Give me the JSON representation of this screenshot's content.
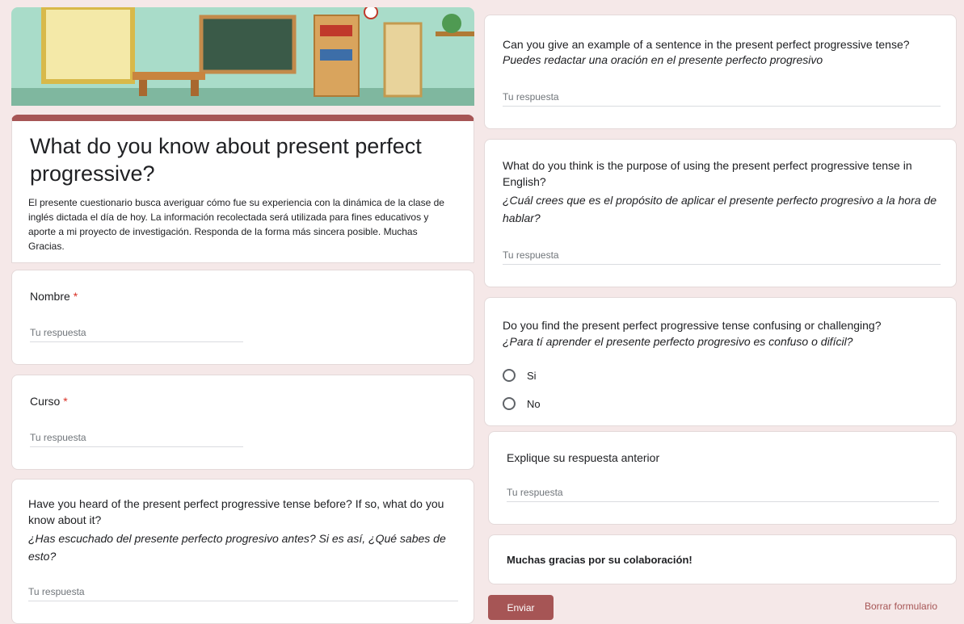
{
  "form": {
    "title": "What do you know about present perfect progressive?",
    "description": "El presente cuestionario busca averiguar cómo fue su experiencia con la dinámica de la clase de inglés dictada el día de hoy. La información recolectada será utilizada para fines educativos y aporte a mi proyecto de investigación. Responda de la forma más sincera posible. Muchas Gracias.",
    "accent_color": "#a65555",
    "placeholder": "Tu respuesta"
  },
  "left": {
    "nombre": {
      "label": "Nombre",
      "required_mark": "*",
      "answer": "Tu respuesta"
    },
    "curso": {
      "label": "Curso",
      "required_mark": "*",
      "answer": "Tu respuesta"
    },
    "heard": {
      "question_en": "Have you heard of the present perfect progressive tense before? If so, what do you know about it?",
      "question_es": "¿Has escuchado del presente perfecto progresivo antes? Si es así, ¿Qué sabes de esto?",
      "answer": "Tu respuesta"
    }
  },
  "right": {
    "example": {
      "question_en": "Can you give an example of a sentence in the present perfect progressive tense?",
      "question_es": "Puedes redactar una oración en el presente perfecto progresivo",
      "answer": "Tu respuesta"
    },
    "purpose": {
      "question_en": "What do you think is the purpose of using the present perfect progressive tense in English?",
      "question_es": "¿Cuál crees que es el propósito de aplicar el presente perfecto progresivo a la hora de hablar?",
      "answer": "Tu respuesta"
    },
    "confusing": {
      "question_en": "Do you find the present perfect progressive tense confusing or challenging?",
      "question_es": "¿Para tí aprender el presente perfecto progresivo es confuso o difícil?",
      "options": [
        "Si",
        "No"
      ]
    },
    "explain": {
      "label": "Explique su respuesta anterior",
      "answer": "Tu respuesta"
    },
    "thanks": "Muchas gracias por su colaboración!"
  },
  "actions": {
    "submit": "Enviar",
    "clear": "Borrar formulario"
  }
}
